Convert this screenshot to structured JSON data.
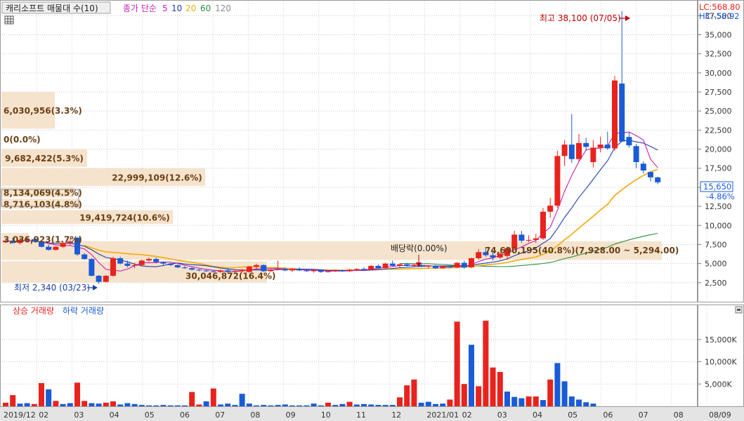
{
  "header": {
    "title": "캐리소프트 매물대 수(10)",
    "ma_label": "종가 단순",
    "ma_periods": [
      "5",
      "10",
      "20",
      "60",
      "120"
    ],
    "lc_label": "LC:568.80",
    "hc_label": "HC:-58.92"
  },
  "colors": {
    "up": "#e8231d",
    "down": "#1a5bd6",
    "ma5": "#c71fb5",
    "ma10": "#1f3db0",
    "ma20": "#f0b11c",
    "ma60": "#2a8f3a",
    "ma120": "#8c8c8c",
    "volume_profile": "#f6e3cd",
    "profile_text": "#6b3f12",
    "lc_text": "#e8231d",
    "hc_text": "#1a5bd6"
  },
  "icons": {
    "grid": "grid-icon",
    "collapse": "collapse-icon"
  },
  "annotations": {
    "high": "최고 38,100 (07/05)",
    "low": "최저 2,340 (03/23)",
    "dividend": "배당락(0.00%)"
  },
  "current_price": {
    "value": "15,650",
    "change": "-4.86%"
  },
  "volume_panel": {
    "legend_up": "상승 거래량",
    "legend_down": "하락 거래량"
  },
  "chart_data": [
    {
      "type": "candlestick",
      "y_ticks": [
        "2,500",
        "5,000",
        "7,500",
        "10,000",
        "12,500",
        "15,000",
        "17,500",
        "20,000",
        "22,500",
        "25,000",
        "27,500",
        "30,000",
        "32,500",
        "35,000",
        "37,500"
      ],
      "ylim": [
        0,
        39000
      ],
      "x_labels": [
        "2019/12",
        "02",
        "03",
        "04",
        "05",
        "06",
        "07",
        "08",
        "09",
        "10",
        "11",
        "12",
        "2021/01",
        "02",
        "03",
        "04",
        "05",
        "06",
        "07",
        "08"
      ],
      "candles": [
        {
          "o": 7800,
          "h": 8100,
          "l": 7700,
          "c": 8000
        },
        {
          "o": 8000,
          "h": 8400,
          "l": 7600,
          "c": 7700
        },
        {
          "o": 7700,
          "h": 8300,
          "l": 7500,
          "c": 8100
        },
        {
          "o": 8100,
          "h": 8500,
          "l": 7900,
          "c": 8200
        },
        {
          "o": 8200,
          "h": 8400,
          "l": 7800,
          "c": 7900
        },
        {
          "o": 7900,
          "h": 8100,
          "l": 7100,
          "c": 7200
        },
        {
          "o": 7200,
          "h": 7500,
          "l": 6700,
          "c": 6800
        },
        {
          "o": 6800,
          "h": 7300,
          "l": 6700,
          "c": 7200
        },
        {
          "o": 7200,
          "h": 7800,
          "l": 7100,
          "c": 7700
        },
        {
          "o": 7700,
          "h": 8300,
          "l": 7400,
          "c": 7900
        },
        {
          "o": 8400,
          "h": 8500,
          "l": 6000,
          "c": 6200
        },
        {
          "o": 6200,
          "h": 6400,
          "l": 5500,
          "c": 5600
        },
        {
          "o": 5600,
          "h": 5700,
          "l": 3300,
          "c": 3400
        },
        {
          "o": 3400,
          "h": 3500,
          "l": 2340,
          "c": 2600
        },
        {
          "o": 2600,
          "h": 3500,
          "l": 2500,
          "c": 3400
        },
        {
          "o": 3400,
          "h": 5900,
          "l": 3300,
          "c": 5700
        },
        {
          "o": 5700,
          "h": 5900,
          "l": 4900,
          "c": 5000
        },
        {
          "o": 5000,
          "h": 5400,
          "l": 4500,
          "c": 4700
        },
        {
          "o": 4700,
          "h": 5100,
          "l": 4400,
          "c": 4800
        },
        {
          "o": 4800,
          "h": 5500,
          "l": 4700,
          "c": 5400
        },
        {
          "o": 5400,
          "h": 5800,
          "l": 5200,
          "c": 5600
        },
        {
          "o": 5600,
          "h": 5800,
          "l": 5000,
          "c": 5200
        },
        {
          "o": 5200,
          "h": 5300,
          "l": 4800,
          "c": 5000
        },
        {
          "o": 5000,
          "h": 5100,
          "l": 4700,
          "c": 4800
        },
        {
          "o": 4800,
          "h": 4900,
          "l": 4400,
          "c": 4500
        },
        {
          "o": 4500,
          "h": 4700,
          "l": 4300,
          "c": 4400
        },
        {
          "o": 4400,
          "h": 4500,
          "l": 4100,
          "c": 4200
        },
        {
          "o": 4200,
          "h": 4300,
          "l": 4000,
          "c": 4100
        },
        {
          "o": 4100,
          "h": 4200,
          "l": 3900,
          "c": 4000
        },
        {
          "o": 4000,
          "h": 4100,
          "l": 3800,
          "c": 3900
        },
        {
          "o": 3900,
          "h": 4200,
          "l": 3800,
          "c": 4100
        },
        {
          "o": 4100,
          "h": 4400,
          "l": 3800,
          "c": 3900
        },
        {
          "o": 3900,
          "h": 4100,
          "l": 3700,
          "c": 4000
        },
        {
          "o": 4000,
          "h": 4300,
          "l": 3800,
          "c": 4200
        },
        {
          "o": 3900,
          "h": 4700,
          "l": 3800,
          "c": 4600
        },
        {
          "o": 4600,
          "h": 5000,
          "l": 4300,
          "c": 4800
        },
        {
          "o": 4800,
          "h": 4900,
          "l": 3900,
          "c": 4000
        },
        {
          "o": 4000,
          "h": 4300,
          "l": 3900,
          "c": 4200
        },
        {
          "o": 4200,
          "h": 5400,
          "l": 4100,
          "c": 4300
        },
        {
          "o": 4300,
          "h": 4500,
          "l": 4000,
          "c": 4100
        },
        {
          "o": 4100,
          "h": 4400,
          "l": 3900,
          "c": 4300
        },
        {
          "o": 4300,
          "h": 4500,
          "l": 4000,
          "c": 4100
        },
        {
          "o": 4100,
          "h": 4300,
          "l": 3900,
          "c": 4000
        },
        {
          "o": 4000,
          "h": 4200,
          "l": 3800,
          "c": 4100
        },
        {
          "o": 4100,
          "h": 4200,
          "l": 3800,
          "c": 3900
        },
        {
          "o": 3900,
          "h": 4100,
          "l": 3800,
          "c": 4000
        },
        {
          "o": 4000,
          "h": 4200,
          "l": 3900,
          "c": 4100
        },
        {
          "o": 4100,
          "h": 4200,
          "l": 3900,
          "c": 4000
        },
        {
          "o": 4000,
          "h": 4300,
          "l": 3900,
          "c": 4200
        },
        {
          "o": 4200,
          "h": 4400,
          "l": 4000,
          "c": 4300
        },
        {
          "o": 4300,
          "h": 4500,
          "l": 4100,
          "c": 4200
        },
        {
          "o": 4200,
          "h": 4800,
          "l": 4100,
          "c": 4700
        },
        {
          "o": 4700,
          "h": 4900,
          "l": 4300,
          "c": 4400
        },
        {
          "o": 4400,
          "h": 5100,
          "l": 4300,
          "c": 5000
        },
        {
          "o": 5000,
          "h": 5400,
          "l": 4600,
          "c": 4700
        },
        {
          "o": 4700,
          "h": 5000,
          "l": 4500,
          "c": 4900
        },
        {
          "o": 4900,
          "h": 5100,
          "l": 4600,
          "c": 4700
        },
        {
          "o": 4700,
          "h": 4900,
          "l": 4500,
          "c": 4800
        },
        {
          "o": 4800,
          "h": 5000,
          "l": 4500,
          "c": 4600
        },
        {
          "o": 4600,
          "h": 4800,
          "l": 4400,
          "c": 4700
        },
        {
          "o": 4700,
          "h": 4800,
          "l": 4300,
          "c": 4400
        },
        {
          "o": 4400,
          "h": 4700,
          "l": 4300,
          "c": 4600
        },
        {
          "o": 4600,
          "h": 4800,
          "l": 4400,
          "c": 4500
        },
        {
          "o": 4500,
          "h": 5200,
          "l": 4400,
          "c": 5100
        },
        {
          "o": 5100,
          "h": 5400,
          "l": 4300,
          "c": 4500
        },
        {
          "o": 4500,
          "h": 5800,
          "l": 4400,
          "c": 5700
        },
        {
          "o": 5700,
          "h": 6900,
          "l": 5500,
          "c": 6500
        },
        {
          "o": 6500,
          "h": 7000,
          "l": 5900,
          "c": 6100
        },
        {
          "o": 6100,
          "h": 6700,
          "l": 5400,
          "c": 5800
        },
        {
          "o": 5800,
          "h": 6500,
          "l": 5600,
          "c": 6300
        },
        {
          "o": 6000,
          "h": 7200,
          "l": 5500,
          "c": 7000
        },
        {
          "o": 7000,
          "h": 9300,
          "l": 6800,
          "c": 8800
        },
        {
          "o": 8800,
          "h": 9300,
          "l": 7700,
          "c": 8000
        },
        {
          "o": 8000,
          "h": 8700,
          "l": 7800,
          "c": 8100
        },
        {
          "o": 8100,
          "h": 8900,
          "l": 7700,
          "c": 8300
        },
        {
          "o": 8300,
          "h": 12300,
          "l": 8100,
          "c": 11800
        },
        {
          "o": 11800,
          "h": 13600,
          "l": 11000,
          "c": 12600
        },
        {
          "o": 12600,
          "h": 19800,
          "l": 12300,
          "c": 19100
        },
        {
          "o": 19100,
          "h": 21200,
          "l": 17800,
          "c": 20600
        },
        {
          "o": 20600,
          "h": 24600,
          "l": 18200,
          "c": 18700
        },
        {
          "o": 18700,
          "h": 22000,
          "l": 18400,
          "c": 20800
        },
        {
          "o": 20800,
          "h": 21500,
          "l": 19800,
          "c": 20300
        },
        {
          "o": 18300,
          "h": 21200,
          "l": 17600,
          "c": 20200
        },
        {
          "o": 20200,
          "h": 21600,
          "l": 19600,
          "c": 20600
        },
        {
          "o": 20600,
          "h": 22300,
          "l": 19900,
          "c": 20100
        },
        {
          "o": 20100,
          "h": 29600,
          "l": 19800,
          "c": 29000
        },
        {
          "o": 28600,
          "h": 38100,
          "l": 21000,
          "c": 21000
        },
        {
          "o": 21600,
          "h": 22300,
          "l": 20200,
          "c": 20500
        },
        {
          "o": 20400,
          "h": 20700,
          "l": 17500,
          "c": 18300
        },
        {
          "o": 18100,
          "h": 18400,
          "l": 16800,
          "c": 17200
        },
        {
          "o": 17000,
          "h": 17100,
          "l": 15800,
          "c": 16300
        },
        {
          "o": 16300,
          "h": 16400,
          "l": 15400,
          "c": 15650
        }
      ],
      "volume_profile": [
        {
          "label": "6,030,956(3.3%)",
          "pct": 3.3,
          "lo": 22500,
          "hi": 27500
        },
        {
          "label": "0(0.0%)",
          "pct": 0.0,
          "lo": 20000,
          "hi": 22500
        },
        {
          "label": "9,682,422(5.3%)",
          "pct": 5.3,
          "lo": 17500,
          "hi": 20000
        },
        {
          "label": "22,999,109(12.6%)",
          "pct": 12.6,
          "lo": 15000,
          "hi": 17500
        },
        {
          "label": "8,134,069(4.5%)",
          "pct": 4.5,
          "lo": 13500,
          "hi": 15000
        },
        {
          "label": "8,716,103(4.8%)",
          "pct": 4.8,
          "lo": 12000,
          "hi": 13500
        },
        {
          "label": "19,419,724(10.6%)",
          "pct": 10.6,
          "lo": 10000,
          "hi": 12000
        },
        {
          "label": "3,036,923(1.7%)",
          "pct": 1.7,
          "lo": 7300,
          "hi": 9000
        },
        {
          "label": "74,690,195(40.8%)(7,928.00 ~ 5,294.00)",
          "pct": 40.8,
          "lo": 5294,
          "hi": 7928
        },
        {
          "label": "30,046,872(16.4%)",
          "pct": 16.4,
          "lo": 2340,
          "hi": 5294
        }
      ]
    },
    {
      "type": "bar",
      "y_ticks": [
        "5,000K",
        "10,000K",
        "15,000K"
      ],
      "ylim": [
        0,
        20000
      ],
      "x_labels": [
        "2019/12",
        "02",
        "03",
        "04",
        "05",
        "06",
        "07",
        "08",
        "09",
        "10",
        "11",
        "12",
        "2021/01",
        "02",
        "03",
        "04",
        "05",
        "06",
        "07",
        "08",
        "08/09"
      ],
      "volume_k": [
        {
          "v": 800,
          "up": true
        },
        {
          "v": 2500,
          "up": true
        },
        {
          "v": 600,
          "up": false
        },
        {
          "v": 700,
          "up": false
        },
        {
          "v": 500,
          "up": true
        },
        {
          "v": 5200,
          "up": true
        },
        {
          "v": 3800,
          "up": false
        },
        {
          "v": 1200,
          "up": true
        },
        {
          "v": 500,
          "up": false
        },
        {
          "v": 700,
          "up": false
        },
        {
          "v": 5300,
          "up": true
        },
        {
          "v": 1200,
          "up": true
        },
        {
          "v": 700,
          "up": false
        },
        {
          "v": 600,
          "up": false
        },
        {
          "v": 800,
          "up": true
        },
        {
          "v": 1100,
          "up": true
        },
        {
          "v": 400,
          "up": false
        },
        {
          "v": 700,
          "up": false
        },
        {
          "v": 500,
          "up": false
        },
        {
          "v": 300,
          "up": false
        },
        {
          "v": 200,
          "up": false
        },
        {
          "v": 200,
          "up": false
        },
        {
          "v": 300,
          "up": false
        },
        {
          "v": 200,
          "up": false
        },
        {
          "v": 200,
          "up": false
        },
        {
          "v": 200,
          "up": false
        },
        {
          "v": 3200,
          "up": true
        },
        {
          "v": 400,
          "up": true
        },
        {
          "v": 1100,
          "up": false
        },
        {
          "v": 4000,
          "up": true
        },
        {
          "v": 400,
          "up": false
        },
        {
          "v": 600,
          "up": false
        },
        {
          "v": 300,
          "up": false
        },
        {
          "v": 2800,
          "up": false
        },
        {
          "v": 600,
          "up": false
        },
        {
          "v": 200,
          "up": false
        },
        {
          "v": 300,
          "up": false
        },
        {
          "v": 200,
          "up": false
        },
        {
          "v": 300,
          "up": false
        },
        {
          "v": 400,
          "up": false
        },
        {
          "v": 200,
          "up": false
        },
        {
          "v": 200,
          "up": false
        },
        {
          "v": 200,
          "up": false
        },
        {
          "v": 600,
          "up": false
        },
        {
          "v": 200,
          "up": false
        },
        {
          "v": 800,
          "up": true
        },
        {
          "v": 300,
          "up": false
        },
        {
          "v": 500,
          "up": false
        },
        {
          "v": 1000,
          "up": true
        },
        {
          "v": 400,
          "up": false
        },
        {
          "v": 500,
          "up": false
        },
        {
          "v": 400,
          "up": false
        },
        {
          "v": 300,
          "up": false
        },
        {
          "v": 300,
          "up": false
        },
        {
          "v": 300,
          "up": false
        },
        {
          "v": 2000,
          "up": true
        },
        {
          "v": 4700,
          "up": true
        },
        {
          "v": 6000,
          "up": true
        },
        {
          "v": 800,
          "up": false
        },
        {
          "v": 1000,
          "up": false
        },
        {
          "v": 500,
          "up": false
        },
        {
          "v": 600,
          "up": false
        },
        {
          "v": 1500,
          "up": true
        },
        {
          "v": 19000,
          "up": true
        },
        {
          "v": 5000,
          "up": true
        },
        {
          "v": 13800,
          "up": false
        },
        {
          "v": 4500,
          "up": true
        },
        {
          "v": 19200,
          "up": true
        },
        {
          "v": 8700,
          "up": true
        },
        {
          "v": 7700,
          "up": true
        },
        {
          "v": 3300,
          "up": false
        },
        {
          "v": 2100,
          "up": false
        },
        {
          "v": 1800,
          "up": false
        },
        {
          "v": 2200,
          "up": true
        },
        {
          "v": 2200,
          "up": true
        },
        {
          "v": 1400,
          "up": false
        },
        {
          "v": 6000,
          "up": true
        },
        {
          "v": 9700,
          "up": false
        },
        {
          "v": 5600,
          "up": false
        },
        {
          "v": 2200,
          "up": false
        },
        {
          "v": 1500,
          "up": false
        },
        {
          "v": 900,
          "up": false
        },
        {
          "v": 600,
          "up": false
        }
      ]
    }
  ]
}
